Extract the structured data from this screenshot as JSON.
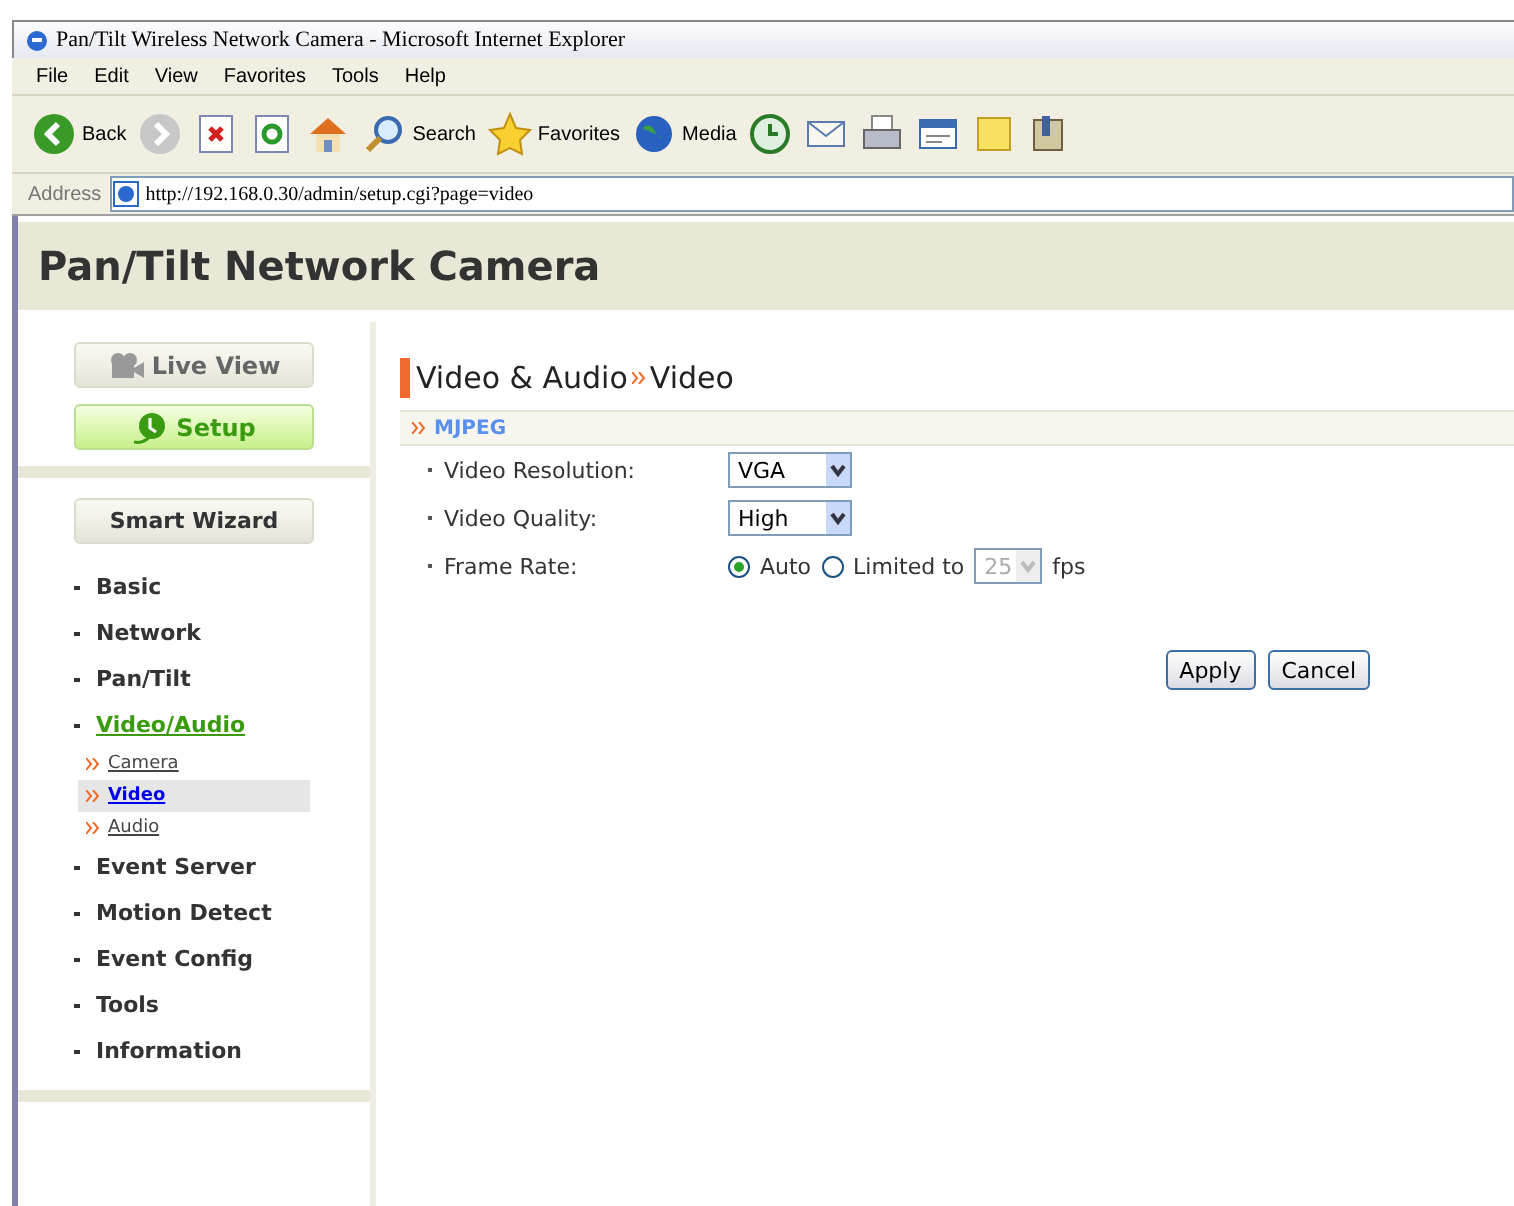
{
  "window": {
    "title": "Pan/Tilt Wireless Network Camera - Microsoft Internet Explorer"
  },
  "menu": [
    "File",
    "Edit",
    "View",
    "Favorites",
    "Tools",
    "Help"
  ],
  "toolbar": [
    {
      "kind": "back",
      "label": "Back"
    },
    {
      "kind": "forward"
    },
    {
      "kind": "stop"
    },
    {
      "kind": "refresh"
    },
    {
      "kind": "home"
    },
    {
      "kind": "search",
      "label": "Search"
    },
    {
      "kind": "favorites",
      "label": "Favorites"
    },
    {
      "kind": "media",
      "label": "Media"
    },
    {
      "kind": "history"
    },
    {
      "kind": "mail"
    },
    {
      "kind": "print"
    },
    {
      "kind": "edit"
    },
    {
      "kind": "note"
    },
    {
      "kind": "tool"
    }
  ],
  "address": {
    "label": "Address",
    "url": "http://192.168.0.30/admin/setup.cgi?page=video"
  },
  "page": {
    "title": "Pan/Tilt Network Camera"
  },
  "mode_buttons": [
    {
      "kind": "live",
      "label": "Live View",
      "selected": false
    },
    {
      "kind": "setup",
      "label": "Setup",
      "selected": true
    }
  ],
  "wizard_button": "Smart Wizard",
  "nav": [
    {
      "label": "Basic",
      "selected": false
    },
    {
      "label": "Network",
      "selected": false
    },
    {
      "label": "Pan/Tilt",
      "selected": false
    },
    {
      "label": "Video/Audio",
      "selected": true,
      "children": [
        {
          "label": "Camera",
          "selected": false
        },
        {
          "label": "Video",
          "selected": true
        },
        {
          "label": "Audio",
          "selected": false
        }
      ]
    },
    {
      "label": "Event Server",
      "selected": false
    },
    {
      "label": "Motion Detect",
      "selected": false
    },
    {
      "label": "Event Config",
      "selected": false
    },
    {
      "label": "Tools",
      "selected": false
    },
    {
      "label": "Information",
      "selected": false
    }
  ],
  "heading": {
    "section": "Video & Audio",
    "page": "Video"
  },
  "subsection": "MJPEG",
  "fields": [
    {
      "kind": "select",
      "label": "Video Resolution:",
      "value": "VGA"
    },
    {
      "kind": "select",
      "label": "Video Quality:",
      "value": "High"
    },
    {
      "kind": "radio",
      "label": "Frame Rate:",
      "options": [
        {
          "label": "Auto",
          "selected": true
        },
        {
          "label": "Limited to",
          "selected": false
        }
      ],
      "value": "25",
      "disabled": true,
      "unit": "fps"
    }
  ],
  "buttons": [
    "Apply",
    "Cancel"
  ]
}
